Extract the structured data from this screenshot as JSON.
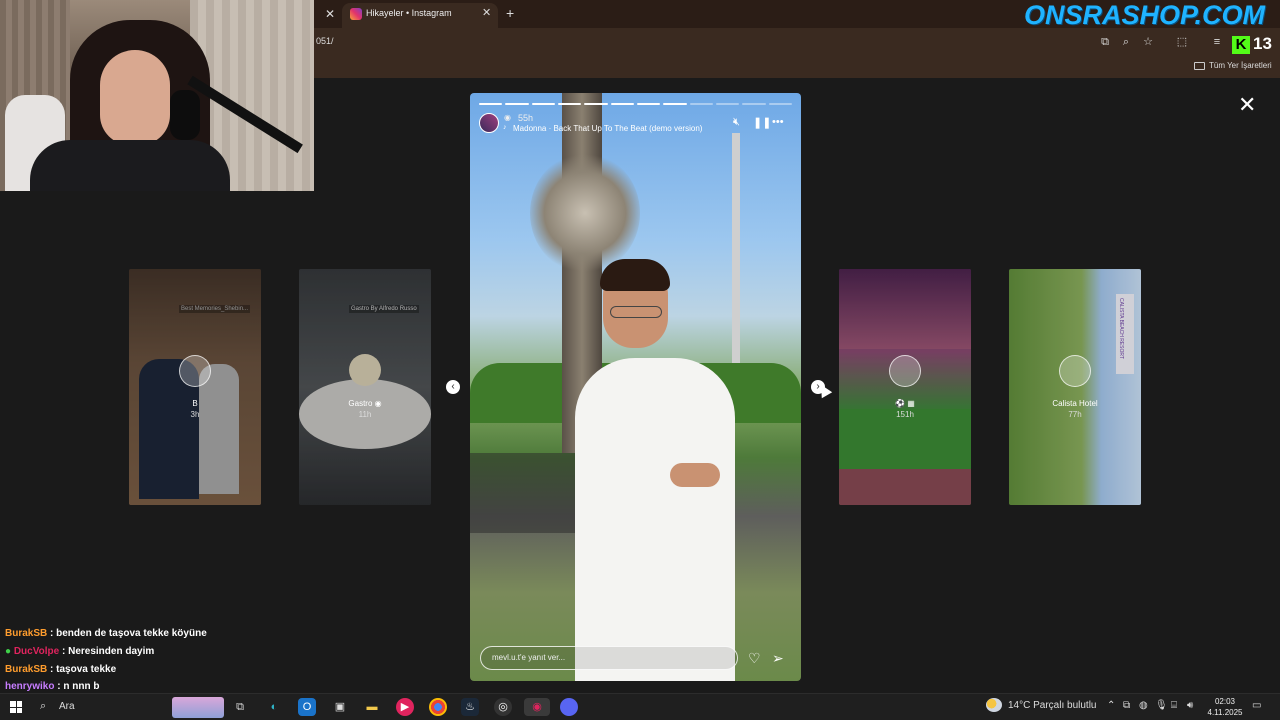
{
  "browser": {
    "tab_title": "Hikayeler • Instagram",
    "url_fragment": "051/",
    "bookmarks_label": "Tüm Yer İşaretleri"
  },
  "overlay": {
    "shop_logo": "ONSRASHOP.COM",
    "kick_letter": "K",
    "kick_number": "13"
  },
  "story_viewer": {
    "side_stories": [
      {
        "name": "B",
        "time": "3h",
        "sign": "Best Memories_Shebin..."
      },
      {
        "name": "Gastro ◉",
        "time": "11h",
        "sign": "Gastro By Alfredo Russo"
      },
      {
        "name": "⚽ ▦",
        "time": "151h"
      },
      {
        "name": "Calista Hotel",
        "time": "77h",
        "sign": "CALISTA BEACH RESORT"
      }
    ],
    "main": {
      "time": "55h",
      "music": "Madonna · Back That Up To The Beat (demo version)",
      "reply_placeholder": "mevl.u.t'e yanıt ver...",
      "progress_total": 12,
      "progress_done": 8
    }
  },
  "chat": [
    {
      "user": "BurakSB",
      "color": "#ff9d2e",
      "message": "benden de taşova tekke köyüne",
      "badge": false
    },
    {
      "user": "DucVolpe",
      "color": "#e0245e",
      "message": "Neresinden dayim",
      "badge": true
    },
    {
      "user": "BurakSB",
      "color": "#ff9d2e",
      "message": "taşova tekke",
      "badge": false
    },
    {
      "user": "henrywiko",
      "color": "#c77dff",
      "message": "n nnn b",
      "badge": false
    }
  ],
  "taskbar": {
    "search_label": "Ara",
    "weather": "14°C  Parçalı bulutlu",
    "time": "02:03",
    "date": "4.11.2025"
  },
  "colors": {
    "accent_logo": "#1fb3ff",
    "kick_green": "#53fc18",
    "background": "#1a1a1a"
  }
}
